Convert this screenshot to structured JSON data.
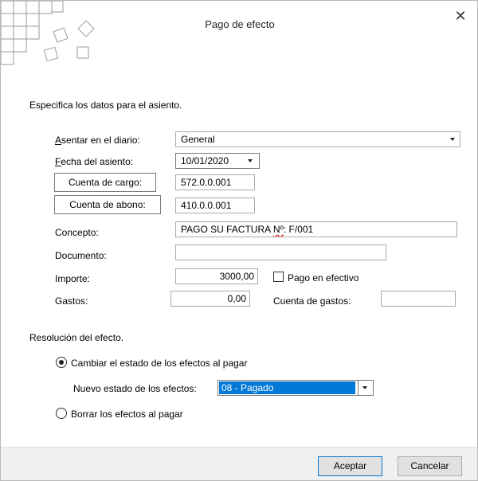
{
  "window": {
    "title": "Pago de efecto",
    "close_icon": "close-icon"
  },
  "intro": "Especifica los datos para el asiento.",
  "form": {
    "diario_label_u": "A",
    "diario_label_rest": "sentar en el diario:",
    "diario_value": "General",
    "fecha_label_u": "F",
    "fecha_label_rest": "echa del asiento:",
    "fecha_value": "10/01/2020",
    "cargo_button": "Cuenta de cargo:",
    "cargo_value": "572.0.0.001",
    "abono_button": "Cuenta de abono:",
    "abono_value": "410.0.0.001",
    "concepto_label": "Concepto:",
    "concepto_value_pre": "PAGO SU FACTURA ",
    "concepto_value_squiggle": "Nº",
    "concepto_value_post": ": F/001",
    "documento_label": "Documento:",
    "documento_value": "",
    "importe_label": "Importe:",
    "importe_value": "3000,00",
    "pago_efectivo_label": "Pago en efectivo",
    "pago_efectivo_checked": false,
    "gastos_label": "Gastos:",
    "gastos_value": "0,00",
    "cuenta_gastos_label": "Cuenta de gastos:",
    "cuenta_gastos_value": ""
  },
  "resolucion": {
    "heading": "Resolución del efecto.",
    "option_cambiar": "Cambiar el estado de los efectos al pagar",
    "nuevo_estado_label": "Nuevo estado de los efectos:",
    "nuevo_estado_value": "08 - Pagado",
    "option_borrar": "Borrar los efectos al pagar",
    "selected": "cambiar"
  },
  "footer": {
    "accept": "Aceptar",
    "cancel": "Cancelar"
  },
  "colors": {
    "accent": "#0078d7",
    "footer_bg": "#f0f0f0"
  }
}
